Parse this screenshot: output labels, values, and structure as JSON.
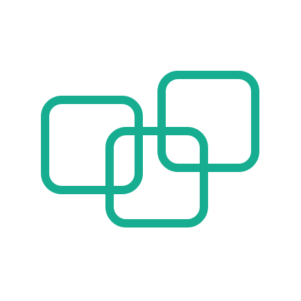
{
  "logo": {
    "icon_name": "three-overlapping-rounded-squares-icon",
    "stroke_color": "#16AD91",
    "background_color": "#FFFFFF"
  }
}
